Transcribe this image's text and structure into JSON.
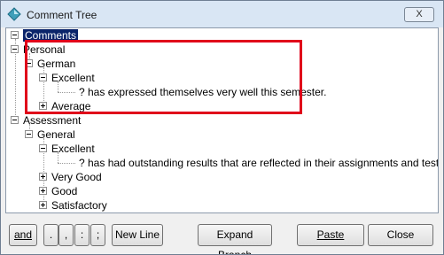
{
  "window": {
    "title": "Comment Tree",
    "close_label": "X"
  },
  "tree": {
    "root": "Comments",
    "personal": "Personal",
    "german": "German",
    "excellent_1": "Excellent",
    "comment_1": "? has expressed themselves very well this semester.",
    "average": "Average",
    "assessment": "Assessment",
    "general": "General",
    "excellent_2": "Excellent",
    "comment_2": "? has had outstanding results that are reflected in their assignments and test results.",
    "very_good": "Very Good",
    "good": "Good",
    "satisfactory": "Satisfactory"
  },
  "buttons": {
    "and": "and",
    "period": ".",
    "comma": ",",
    "colon": ":",
    "semicolon": ";",
    "new_line": "New Line",
    "expand_branch": "Expand Branch",
    "paste": "Paste",
    "close": "Close"
  },
  "colors": {
    "highlight": "#e0001a",
    "selection": "#0a246a"
  },
  "icons": {
    "app": "diamond-app-icon"
  }
}
